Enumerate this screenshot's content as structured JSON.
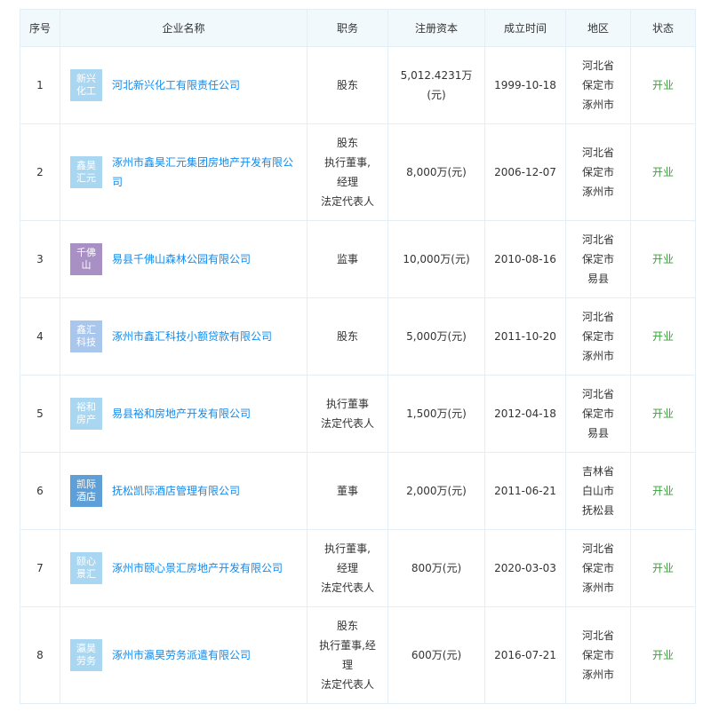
{
  "headers": {
    "index": "序号",
    "company": "企业名称",
    "position": "职务",
    "capital": "注册资本",
    "founded": "成立时间",
    "region": "地区",
    "status": "状态"
  },
  "rows": [
    {
      "index": "1",
      "logo_text": "新兴化工",
      "logo_color": "#a9d7f2",
      "name": "河北新兴化工有限责任公司",
      "position": [
        "股东"
      ],
      "capital": [
        "5,012.4231万",
        "(元)"
      ],
      "founded": "1999-10-18",
      "region": [
        "河北省",
        "保定市",
        "涿州市"
      ],
      "status": "开业"
    },
    {
      "index": "2",
      "logo_text": "鑫昊汇元",
      "logo_color": "#a9d7f2",
      "name": "涿州市鑫昊汇元集团房地产开发有限公司",
      "position": [
        "股东",
        "执行董事,",
        "经理",
        "法定代表人"
      ],
      "capital": [
        "8,000万(元)"
      ],
      "founded": "2006-12-07",
      "region": [
        "河北省",
        "保定市",
        "涿州市"
      ],
      "status": "开业"
    },
    {
      "index": "3",
      "logo_text": "千佛山",
      "logo_color": "#a88fc4",
      "name": "易县千佛山森林公园有限公司",
      "position": [
        "监事"
      ],
      "capital": [
        "10,000万(元)"
      ],
      "founded": "2010-08-16",
      "region": [
        "河北省",
        "保定市",
        "易县"
      ],
      "status": "开业"
    },
    {
      "index": "4",
      "logo_text": "鑫汇科技",
      "logo_color": "#a9c6ec",
      "name": "涿州市鑫汇科技小额贷款有限公司",
      "position": [
        "股东"
      ],
      "capital": [
        "5,000万(元)"
      ],
      "founded": "2011-10-20",
      "region": [
        "河北省",
        "保定市",
        "涿州市"
      ],
      "status": "开业"
    },
    {
      "index": "5",
      "logo_text": "裕和房产",
      "logo_color": "#a9d7f2",
      "name": "易县裕和房地产开发有限公司",
      "position": [
        "执行董事",
        "法定代表人"
      ],
      "capital": [
        "1,500万(元)"
      ],
      "founded": "2012-04-18",
      "region": [
        "河北省",
        "保定市",
        "易县"
      ],
      "status": "开业"
    },
    {
      "index": "6",
      "logo_text": "凯际酒店",
      "logo_color": "#5e9fd8",
      "name": "抚松凯际酒店管理有限公司",
      "position": [
        "董事"
      ],
      "capital": [
        "2,000万(元)"
      ],
      "founded": "2011-06-21",
      "region": [
        "吉林省",
        "白山市",
        "抚松县"
      ],
      "status": "开业"
    },
    {
      "index": "7",
      "logo_text": "颐心景汇",
      "logo_color": "#a9d7f2",
      "name": "涿州市颐心景汇房地产开发有限公司",
      "position": [
        "执行董事,",
        "经理",
        "法定代表人"
      ],
      "capital": [
        "800万(元)"
      ],
      "founded": "2020-03-03",
      "region": [
        "河北省",
        "保定市",
        "涿州市"
      ],
      "status": "开业"
    },
    {
      "index": "8",
      "logo_text": "瀛昊劳务",
      "logo_color": "#a9d7f2",
      "name": "涿州市瀛昊劳务派遣有限公司",
      "position": [
        "股东",
        "执行董事,经",
        "理",
        "法定代表人"
      ],
      "capital": [
        "600万(元)"
      ],
      "founded": "2016-07-21",
      "region": [
        "河北省",
        "保定市",
        "涿州市"
      ],
      "status": "开业"
    }
  ]
}
